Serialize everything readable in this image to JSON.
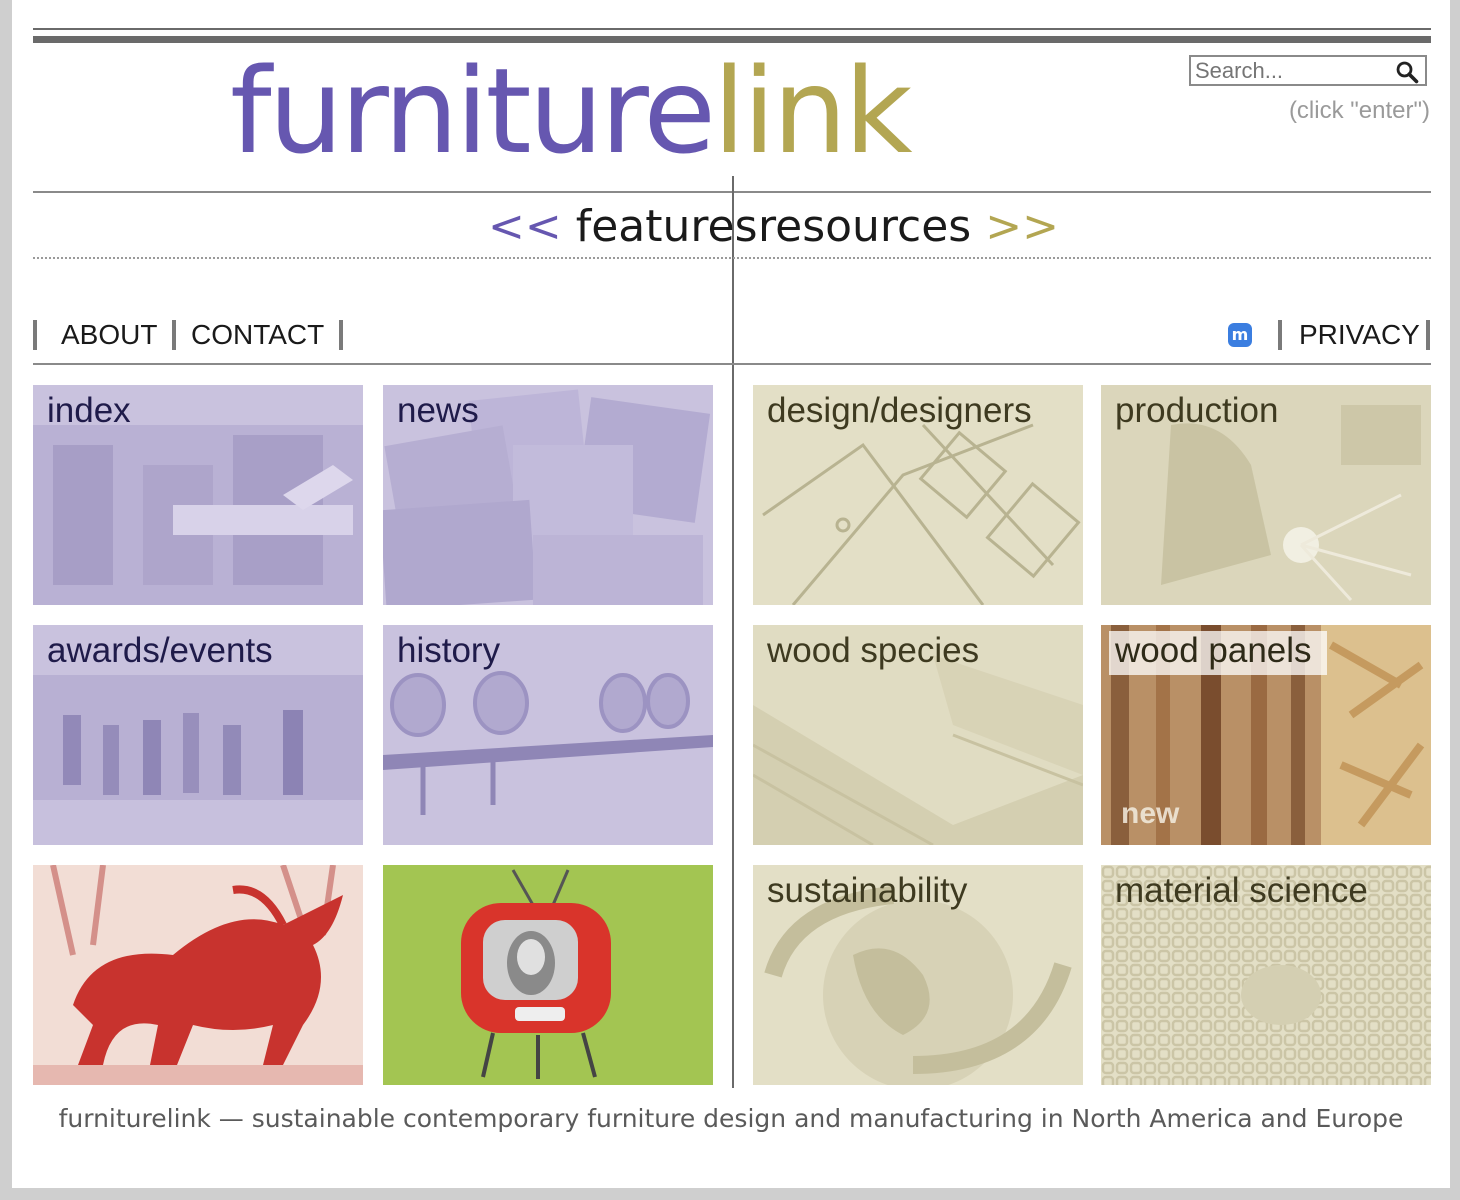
{
  "logo": {
    "part1": "furniture",
    "part2": "link"
  },
  "search": {
    "placeholder": "Search...",
    "hint": "(click \"enter\")"
  },
  "sections": {
    "features": {
      "arrow": "<<",
      "label": "features"
    },
    "resources": {
      "label": "resources",
      "arrow": ">>"
    }
  },
  "nav": {
    "about": "ABOUT",
    "contact": "CONTACT",
    "privacy": "PRIVACY"
  },
  "features_tiles": [
    "index",
    "news",
    "awards/events",
    "history"
  ],
  "resources_tiles": [
    "design/designers",
    "production",
    "wood species",
    "wood panels",
    "sustainability",
    "material science"
  ],
  "new_badge": "new",
  "tagline": "furniturelink — sustainable contemporary furniture design and manufacturing in North America and Europe",
  "colors": {
    "purple": "#6657b0",
    "olive": "#b3a652",
    "tile_purple": "#c9c2de",
    "tile_tan": "#e3dfc6",
    "tv_green": "#a3c552",
    "bull_red": "#c8332e"
  }
}
